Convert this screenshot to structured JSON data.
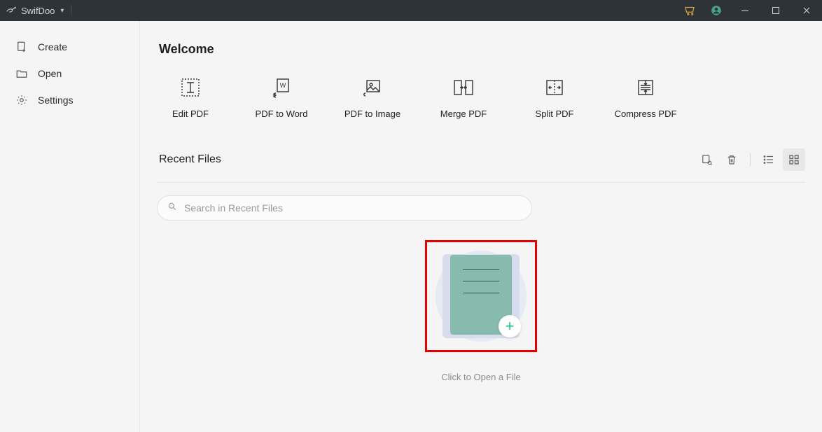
{
  "titlebar": {
    "app_name": "SwifDoo"
  },
  "sidebar": {
    "items": [
      {
        "label": "Create"
      },
      {
        "label": "Open"
      },
      {
        "label": "Settings"
      }
    ]
  },
  "main": {
    "welcome_title": "Welcome",
    "tools": [
      {
        "label": "Edit PDF"
      },
      {
        "label": "PDF to Word"
      },
      {
        "label": "PDF to Image"
      },
      {
        "label": "Merge PDF"
      },
      {
        "label": "Split PDF"
      },
      {
        "label": "Compress PDF"
      }
    ],
    "recent": {
      "title": "Recent Files",
      "search_placeholder": "Search in Recent Files",
      "open_caption": "Click to Open a File"
    }
  }
}
